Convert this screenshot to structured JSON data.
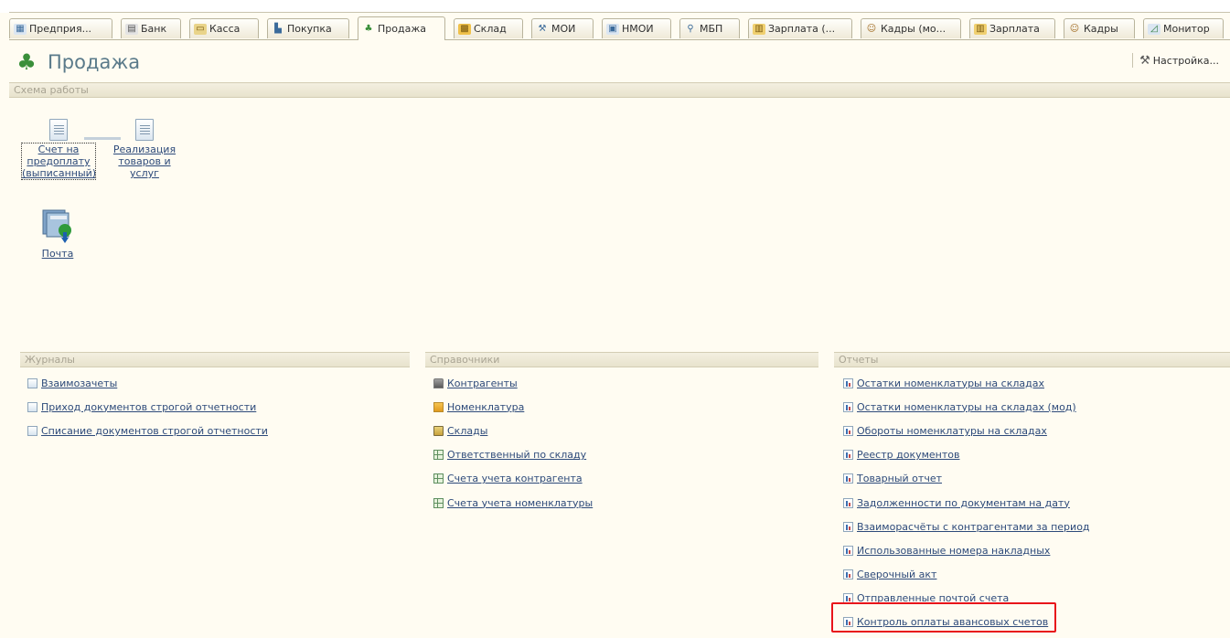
{
  "tabs": [
    {
      "label": "Предприя...",
      "icon": "enterprise-icon"
    },
    {
      "label": "Банк",
      "icon": "bank-icon"
    },
    {
      "label": "Касса",
      "icon": "cash-icon"
    },
    {
      "label": "Покупка",
      "icon": "purchase-icon"
    },
    {
      "label": "Продажа",
      "icon": "sale-icon",
      "active": true
    },
    {
      "label": "Склад",
      "icon": "warehouse-icon"
    },
    {
      "label": "МОИ",
      "icon": "moi-icon"
    },
    {
      "label": "НМОИ",
      "icon": "nmoi-icon"
    },
    {
      "label": "МБП",
      "icon": "mbp-icon"
    },
    {
      "label": "Зарплата (...",
      "icon": "salary-icon"
    },
    {
      "label": "Кадры (мо...",
      "icon": "personnel-icon"
    },
    {
      "label": "Зарплата",
      "icon": "salary-icon"
    },
    {
      "label": "Кадры",
      "icon": "personnel-icon"
    },
    {
      "label": "Монитор",
      "icon": "monitor-icon"
    }
  ],
  "page": {
    "title": "Продажа",
    "settings_label": "Настройка..."
  },
  "scheme": {
    "header": "Схема работы",
    "invoice_label": "Счет на предоплату (выписанный)",
    "sales_label": "Реализация товаров и услуг",
    "mail_label": "Почта"
  },
  "journals": {
    "header": "Журналы",
    "items": [
      {
        "label": "Взаимозачеты"
      },
      {
        "label": "Приход документов строгой отчетности"
      },
      {
        "label": "Списание документов строгой отчетности"
      }
    ]
  },
  "catalogs": {
    "header": "Справочники",
    "items": [
      {
        "label": "Контрагенты",
        "icon": "people-icon"
      },
      {
        "label": "Номенклатура",
        "icon": "box-icon"
      },
      {
        "label": "Склады",
        "icon": "folder-icon"
      },
      {
        "label": "Ответственный по складу",
        "icon": "grid-icon"
      },
      {
        "label": "Счета учета контрагента",
        "icon": "grid-icon"
      },
      {
        "label": "Счета учета номенклатуры",
        "icon": "grid-icon"
      }
    ]
  },
  "reports": {
    "header": "Отчеты",
    "items": [
      {
        "label": "Остатки номенклатуры на складах"
      },
      {
        "label": "Остатки номенклатуры на складах (мод)"
      },
      {
        "label": "Обороты номенклатуры на складах"
      },
      {
        "label": "Реестр документов"
      },
      {
        "label": "Товарный отчет"
      },
      {
        "label": "Задолженности по документам на дату"
      },
      {
        "label": "Взаиморасчёты с контрагентами за период"
      },
      {
        "label": "Использованные номера накладных"
      },
      {
        "label": "Сверочный акт"
      },
      {
        "label": "Отправленные почтой счета"
      },
      {
        "label": "Контроль оплаты авансовых счетов",
        "highlighted": true
      }
    ]
  },
  "colors": {
    "highlight": "#e8141b",
    "link": "#2d4a7a",
    "background": "#fffcf2"
  }
}
